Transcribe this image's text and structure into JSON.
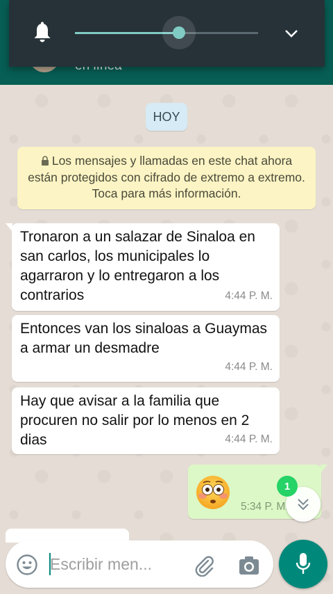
{
  "header": {
    "status": "en línea"
  },
  "volume": {
    "level": 0.57
  },
  "chat": {
    "date_chip": "HOY",
    "encryption_notice": "Los mensajes y llamadas en este chat ahora están protegidos con cifrado de extremo a extremo. Toca para más información.",
    "messages": [
      {
        "direction": "in",
        "text": "Tronaron a un salazar de Sinaloa en san carlos, los municipales lo agarraron y lo entregaron a los contrarios",
        "time": "4:44 P. M."
      },
      {
        "direction": "in",
        "text": "Entonces van los sinaloas a Guaymas a armar un desmadre",
        "time": "4:44 P. M."
      },
      {
        "direction": "in",
        "text": "Hay que avisar a la familia que procuren no salir por lo menos en 2 dias",
        "time": "4:44 P. M."
      },
      {
        "direction": "out",
        "emoji": "flushed-face",
        "time": "5:34 P. M."
      }
    ],
    "unread_count": "1"
  },
  "composer": {
    "placeholder": "Escribir men...",
    "value": ""
  },
  "icons": {
    "volume": "bell-icon",
    "expand": "chevron-down-icon",
    "scroll": "double-chevron-down-icon",
    "emoji": "smiley-icon",
    "attach": "paperclip-icon",
    "camera": "camera-icon",
    "mic": "mic-icon"
  },
  "colors": {
    "header": "#075e54",
    "outgoing_bubble": "#dcf8c6",
    "accent": "#00897b",
    "badge": "#25d366",
    "slider": "#80cbc4"
  }
}
